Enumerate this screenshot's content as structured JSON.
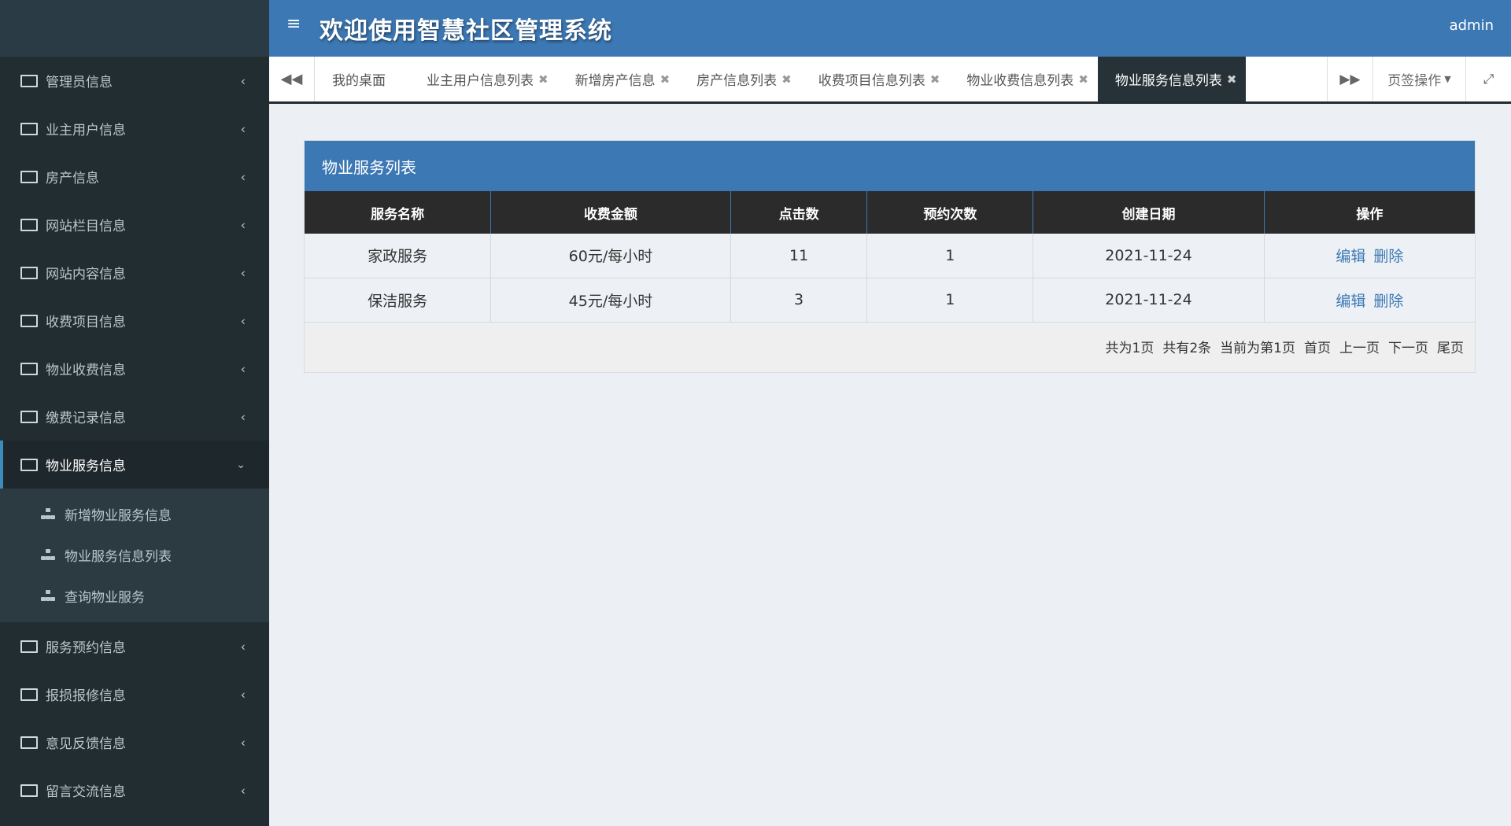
{
  "header": {
    "menu_icon": "≡",
    "title": "欢迎使用智慧社区管理系统",
    "user": "admin"
  },
  "sidebar": {
    "items_before": [
      {
        "label": "管理员信息"
      },
      {
        "label": "业主用户信息"
      },
      {
        "label": "房产信息"
      },
      {
        "label": "网站栏目信息"
      },
      {
        "label": "网站内容信息"
      },
      {
        "label": "收费项目信息"
      },
      {
        "label": "物业收费信息"
      },
      {
        "label": "缴费记录信息"
      }
    ],
    "active": {
      "label": "物业服务信息"
    },
    "sub_items": [
      {
        "label": "新增物业服务信息"
      },
      {
        "label": "物业服务信息列表"
      },
      {
        "label": "查询物业服务"
      }
    ],
    "items_after": [
      {
        "label": "服务预约信息"
      },
      {
        "label": "报损报修信息"
      },
      {
        "label": "意见反馈信息"
      },
      {
        "label": "留言交流信息"
      }
    ]
  },
  "tabs": [
    {
      "label": "我的桌面"
    },
    {
      "label": "业主用户信息列表"
    },
    {
      "label": "新增房产信息"
    },
    {
      "label": "房产信息列表"
    },
    {
      "label": "收费项目信息列表"
    },
    {
      "label": "物业收费信息列表"
    },
    {
      "label": "物业服务信息列表"
    }
  ],
  "tab_controls": {
    "page_ops": "页签操作"
  },
  "panel": {
    "title": "物业服务列表",
    "columns": [
      "服务名称",
      "收费金额",
      "点击数",
      "预约次数",
      "创建日期",
      "操作"
    ],
    "rows": [
      {
        "name": "家政服务",
        "price": "60元/每小时",
        "clicks": "11",
        "bookings": "1",
        "date": "2021-11-24",
        "edit": "编辑",
        "delete": "删除"
      },
      {
        "name": "保洁服务",
        "price": "45元/每小时",
        "clicks": "3",
        "bookings": "1",
        "date": "2021-11-24",
        "edit": "编辑",
        "delete": "删除"
      }
    ],
    "pager": {
      "total_pages": "共为1页",
      "total_items": "共有2条",
      "current": "当前为第1页",
      "first": "首页",
      "prev": "上一页",
      "next": "下一页",
      "last": "尾页"
    }
  },
  "colors": {
    "header_blue": "#3c78b4",
    "sidebar_dark": "#222d32",
    "link_blue": "#3c78b4"
  }
}
